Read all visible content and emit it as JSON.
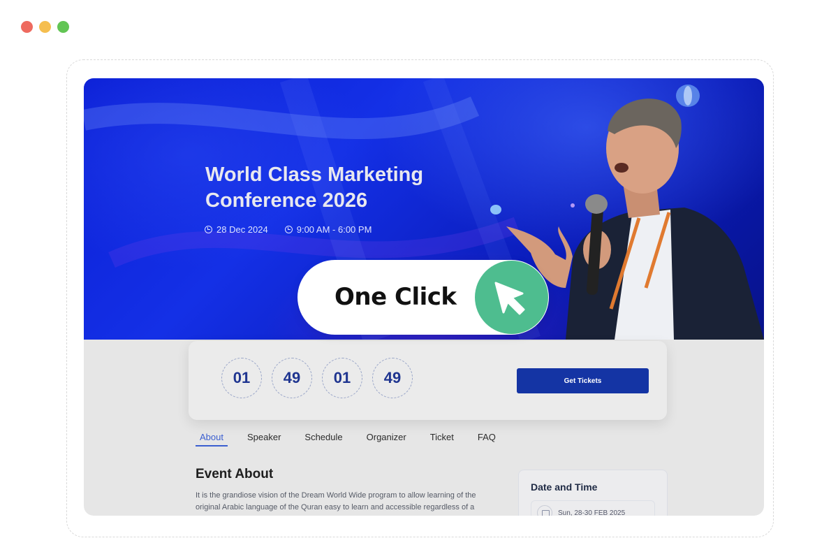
{
  "window": {
    "dots": [
      "#ee6a5f",
      "#f5be4f",
      "#62c554"
    ]
  },
  "hero": {
    "title": "World Class Marketing Conference 2026",
    "date": "28 Dec 2024",
    "time": "9:00 AM - 6:00 PM",
    "date_icon": "clock-icon",
    "time_icon": "clock-icon"
  },
  "countdown": {
    "values": [
      "01",
      "49",
      "01",
      "49"
    ],
    "button_label": "Get Tickets"
  },
  "tabs": [
    {
      "label": "About",
      "active": true
    },
    {
      "label": "Speaker",
      "active": false
    },
    {
      "label": "Schedule",
      "active": false
    },
    {
      "label": "Organizer",
      "active": false
    },
    {
      "label": "Ticket",
      "active": false
    },
    {
      "label": "FAQ",
      "active": false
    }
  ],
  "about": {
    "title": "Event About",
    "text": "It is the grandiose vision of the Dream World Wide program to allow learning of the original Arabic language of the Quran easy to learn and accessible regardless of a"
  },
  "date_card": {
    "title": "Date and Time",
    "date_value": "Sun, 28-30 FEB 2025",
    "icon": "calendar-icon"
  },
  "overlay": {
    "label": "One Click",
    "icon": "cursor-arrow-icon"
  },
  "colors": {
    "accent": "#1434a4",
    "cursor_bg": "#4ebd8f",
    "tab_active": "#3b5fd0"
  }
}
